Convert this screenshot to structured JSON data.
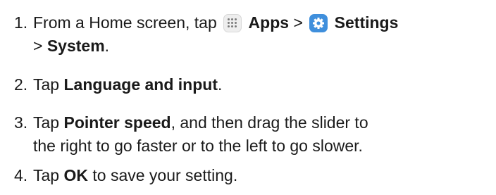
{
  "steps": [
    {
      "num": "1.",
      "pre": "From a Home screen, tap",
      "apps_icon": "apps-icon",
      "apps": "Apps",
      "sep1": ">",
      "settings_icon": "settings-gear-icon",
      "settings": "Settings",
      "sep2": ">",
      "system": "System",
      "end": "."
    },
    {
      "num": "2.",
      "pre": "Tap",
      "bold": "Language and input",
      "end": "."
    },
    {
      "num": "3.",
      "pre": "Tap",
      "bold": "Pointer speed",
      "rest_line1": ", and then drag the slider to",
      "rest_line2": "the right to go faster or to the left to go slower."
    },
    {
      "num": "4.",
      "pre": "Tap",
      "bold": "OK",
      "rest": "to save your setting."
    }
  ],
  "colors": {
    "text": "#1a1a1a",
    "settings_icon_bg": "#3f8fdc",
    "apps_icon_bg": "#eeeeee"
  }
}
